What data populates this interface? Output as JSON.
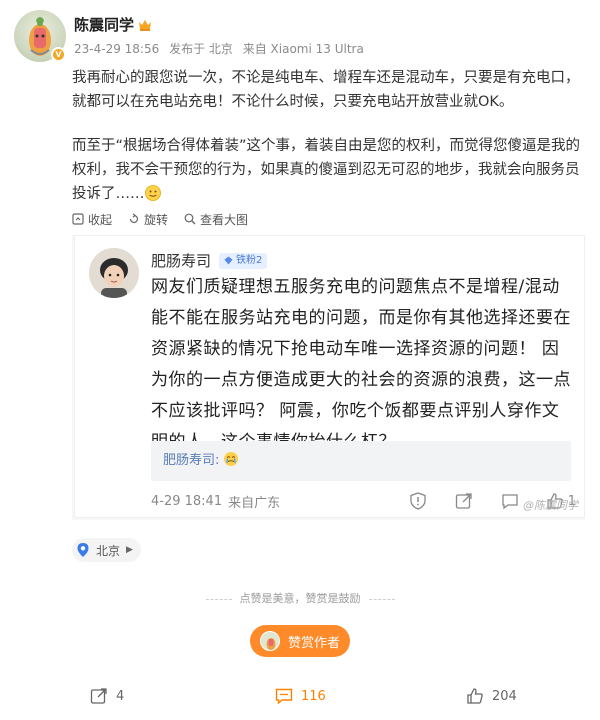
{
  "post": {
    "author": "陈震同学",
    "date": "23-4-29 18:56",
    "location_label": "发布于 北京",
    "device": "来自 Xiaomi 13 Ultra",
    "paragraph1": "我再耐心的跟您说一次，不论是纯电车、增程车还是混动车，只要是有充电口，就都可以在充电站充电！不论什么时候，只要充电站开放营业就OK。",
    "paragraph2": "而至于“根据场合得体着装”这个事，着装自由是您的权利，而觉得您傻逼是我的权利，我不会干预您的行为，如果真的傻逼到忍无可忍的地步，我就会向服务员投诉了……"
  },
  "pic_actions": {
    "collect": "收起",
    "rotate": "旋转",
    "view_large": "查看大图"
  },
  "quote": {
    "name": "肥肠寿司",
    "fan_badge": "铁粉2",
    "text": "网友们质疑理想五服务充电的问题焦点不是增程/混动能不能在服务站充电的问题，而是你有其他选择还要在资源紧缺的情况下抢电动车唯一选择资源的问题！ 因为你的一点方便造成更大的社会的资源的浪费，这一点不应该批评吗？ 阿震，你吃个饭都要点评别人穿作文明的人，这个事情你抬什么杠？",
    "reply_name": "肥肠寿司:",
    "footer_time": "4-29 18:41",
    "footer_from": "来自广东",
    "like_count": "1",
    "watermark": "@陈震同学"
  },
  "location": "北京",
  "reward": {
    "note": "点赞是美意，赞赏是鼓励",
    "button": "赞赏作者"
  },
  "toolbar": {
    "forward": "4",
    "comments": "116",
    "likes": "204"
  },
  "colors": {
    "accent": "#ff8200",
    "reward": "#ff8a2a",
    "link": "#5a7db8"
  }
}
